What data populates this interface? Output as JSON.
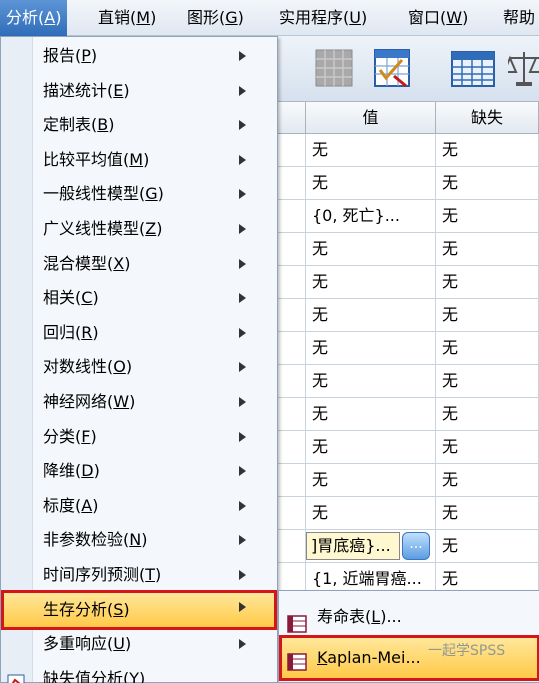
{
  "menubar": {
    "items": [
      {
        "label": "分析(A)",
        "text": "分析",
        "key": "A"
      },
      {
        "label": "直销(M)",
        "text": "直销",
        "key": "M"
      },
      {
        "label": "图形(G)",
        "text": "图形",
        "key": "G"
      },
      {
        "label": "实用程序(U)",
        "text": "实用程序",
        "key": "U"
      },
      {
        "label": "窗口(W)",
        "text": "窗口",
        "key": "W"
      },
      {
        "label": "帮助",
        "text": "帮助",
        "key": ""
      }
    ]
  },
  "toolbar": {
    "icons": [
      "grid-disabled-icon",
      "select-cases-icon",
      "table-icon",
      "scale-icon"
    ]
  },
  "grid": {
    "columns": [
      "值",
      "缺失"
    ],
    "rows": [
      {
        "value": "无",
        "missing": "无"
      },
      {
        "value": "无",
        "missing": "无"
      },
      {
        "value": "{0, 死亡}...",
        "missing": "无"
      },
      {
        "value": "无",
        "missing": "无"
      },
      {
        "value": "无",
        "missing": "无"
      },
      {
        "value": "无",
        "missing": "无"
      },
      {
        "value": "无",
        "missing": "无"
      },
      {
        "value": "无",
        "missing": "无"
      },
      {
        "value": "无",
        "missing": "无"
      },
      {
        "value": "无",
        "missing": "无"
      },
      {
        "value": "无",
        "missing": "无"
      },
      {
        "value": "无",
        "missing": "无"
      },
      {
        "value": "]胃底癌}...",
        "missing": "无",
        "editing": true,
        "button": "..."
      },
      {
        "value": "{1, 近端胃癌...",
        "missing": "无"
      }
    ]
  },
  "analyze_menu": {
    "items": [
      {
        "text": "报告",
        "key": "P"
      },
      {
        "text": "描述统计",
        "key": "E"
      },
      {
        "text": "定制表",
        "key": "B"
      },
      {
        "text": "比较平均值",
        "key": "M"
      },
      {
        "text": "一般线性模型",
        "key": "G"
      },
      {
        "text": "广义线性模型",
        "key": "Z"
      },
      {
        "text": "混合模型",
        "key": "X"
      },
      {
        "text": "相关",
        "key": "C"
      },
      {
        "text": "回归",
        "key": "R"
      },
      {
        "text": "对数线性",
        "key": "O"
      },
      {
        "text": "神经网络",
        "key": "W"
      },
      {
        "text": "分类",
        "key": "F"
      },
      {
        "text": "降维",
        "key": "D"
      },
      {
        "text": "标度",
        "key": "A"
      },
      {
        "text": "非参数检验",
        "key": "N"
      },
      {
        "text": "时间序列预测",
        "key": "T"
      },
      {
        "text": "生存分析",
        "key": "S",
        "highlighted": true
      },
      {
        "text": "多重响应",
        "key": "U"
      },
      {
        "text": "缺失值分析",
        "key": "Y",
        "partial": true
      }
    ]
  },
  "survival_submenu": {
    "items": [
      {
        "text": "寿命表",
        "key": "L",
        "suffix": "..."
      },
      {
        "text": "aplan-Mei",
        "key": "K",
        "suffix": "...",
        "highlighted": true
      }
    ]
  },
  "watermark": "一起学SPSS",
  "colors": {
    "highlight_border": "#d4161b",
    "highlight_fill": "#ffd45e",
    "menubar_active": "#2f6db8"
  }
}
